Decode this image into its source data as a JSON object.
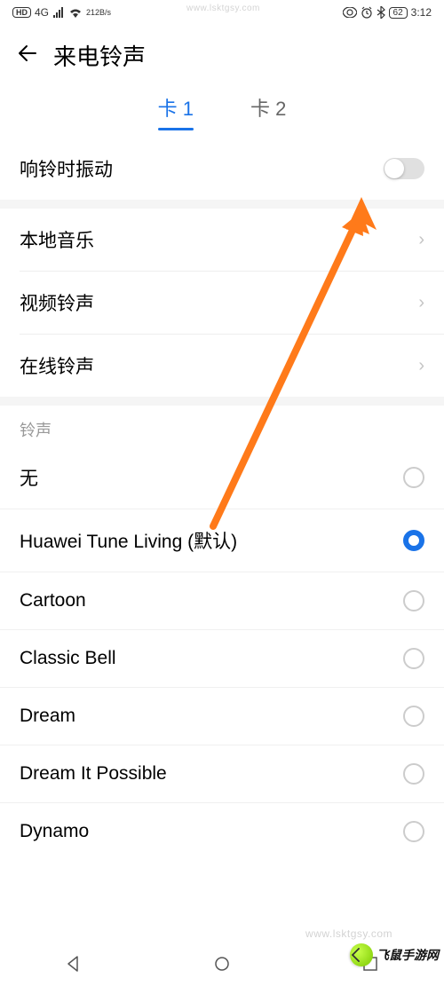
{
  "status": {
    "hd": "HD",
    "signal_gen": "4G",
    "speed_value": "212",
    "speed_unit": "B/s",
    "battery": "62",
    "time": "3:12"
  },
  "header": {
    "title": "来电铃声"
  },
  "tabs": {
    "sim1": "卡 1",
    "sim2": "卡 2"
  },
  "vibrate": {
    "label": "响铃时振动"
  },
  "sources": {
    "local": "本地音乐",
    "video": "视频铃声",
    "online": "在线铃声"
  },
  "section": {
    "label": "铃声"
  },
  "ringtones": {
    "none": "无",
    "default": "Huawei Tune Living (默认)",
    "cartoon": "Cartoon",
    "classic": "Classic Bell",
    "dream": "Dream",
    "dreamit": "Dream It Possible",
    "dynamo": "Dynamo"
  },
  "watermark": {
    "domain_top": "www.lsktgsy.com",
    "domain_bottom": "www.lsktgsy.com",
    "brand": "飞鼠手游网"
  }
}
